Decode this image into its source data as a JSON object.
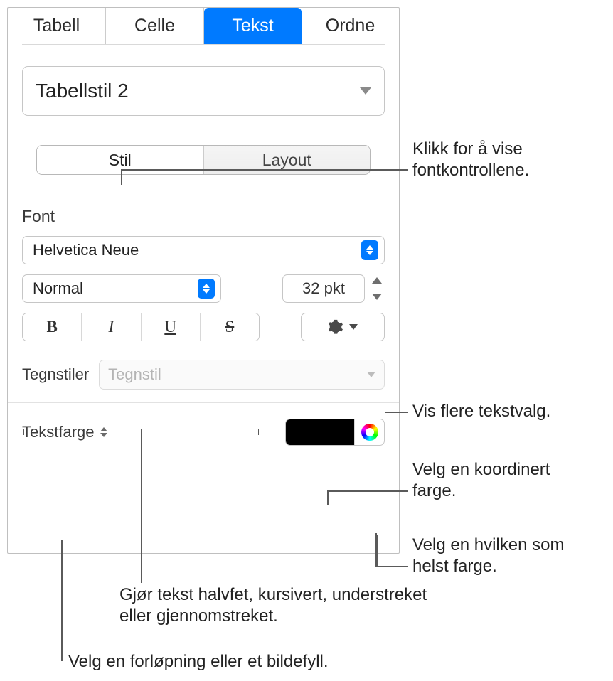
{
  "tabs": {
    "tabell": "Tabell",
    "celle": "Celle",
    "tekst": "Tekst",
    "ordne": "Ordne"
  },
  "styleSelect": "Tabellstil 2",
  "segment": {
    "stil": "Stil",
    "layout": "Layout"
  },
  "fontLabel": "Font",
  "fontFamily": "Helvetica Neue",
  "fontWeight": "Normal",
  "fontSize": "32 pkt",
  "biu": {
    "b": "B",
    "i": "I",
    "u": "U",
    "s": "S"
  },
  "charStyleLabel": "Tegnstiler",
  "charStylePlaceholder": "Tegnstil",
  "textColorLabel": "Tekstfarge",
  "callouts": {
    "fontControls": "Klikk for å vise fontkontrollene.",
    "moreText": "Vis flere tekstvalg.",
    "coordColor": "Velg en koordinert farge.",
    "anyColor": "Velg en hvilken som helst farge.",
    "biuCallout": "Gjør tekst halvfet, kursivert, understreket eller gjennomstreket.",
    "gradientFill": "Velg en forløpning eller et bildefyll."
  }
}
